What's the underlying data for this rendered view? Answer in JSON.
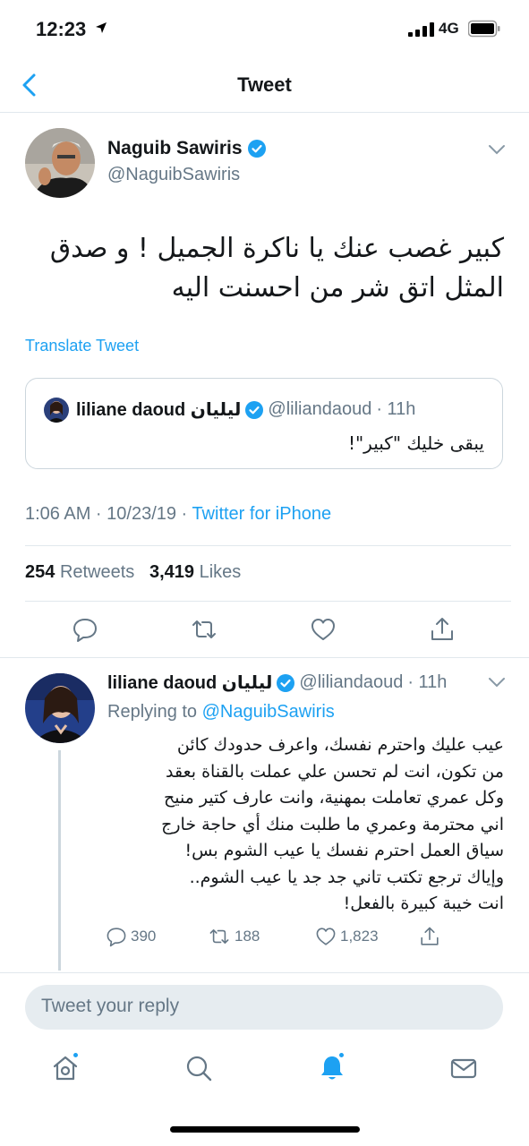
{
  "status": {
    "time": "12:23",
    "network": "4G"
  },
  "nav": {
    "title": "Tweet"
  },
  "tweet": {
    "author_name": "Naguib Sawiris",
    "author_handle": "@NaguibSawiris",
    "text": "كبير غصب عنك يا ناكرة الجميل ! و صدق المثل اتق شر من احسنت اليه",
    "translate_label": "Translate Tweet",
    "quote": {
      "name": "liliane daoud ليليان",
      "handle": "@liliandaoud",
      "time": "· 11h",
      "text": "يبقى خليك \"كبير\"!"
    },
    "timestamp": "1:06 AM · 10/23/19 ·",
    "source": "Twitter for iPhone",
    "retweets_count": "254",
    "retweets_label": "Retweets",
    "likes_count": "3,419",
    "likes_label": "Likes"
  },
  "reply": {
    "name": "liliane daoud ليليان",
    "handle": "@liliandaoud",
    "time": "· 11h",
    "replying_label": "Replying to",
    "replying_to": "@NaguibSawiris",
    "lines": [
      "عيب عليك واحترم نفسك، واعرف حدودك كائن",
      "من تكون، انت لم تحسن علي عملت بالقناة بعقد",
      "وكل عمري تعاملت بمهنية، وانت عارف كتير منيح",
      "اني محترمة وعمري ما طلبت منك أي حاجة خارج",
      "سياق العمل احترم نفسك يا عيب الشوم بس!",
      "وإياك ترجع تكتب تاني جد جد يا عيب الشوم..",
      "انت خيبة كبيرة بالفعل!"
    ],
    "replies_count": "390",
    "retweets_count": "188",
    "likes_count": "1,823"
  },
  "reply_input": {
    "placeholder": "Tweet your reply"
  },
  "colors": {
    "accent": "#1da1f2",
    "muted": "#657786",
    "text": "#14171a",
    "divider": "#e1e8ed"
  }
}
